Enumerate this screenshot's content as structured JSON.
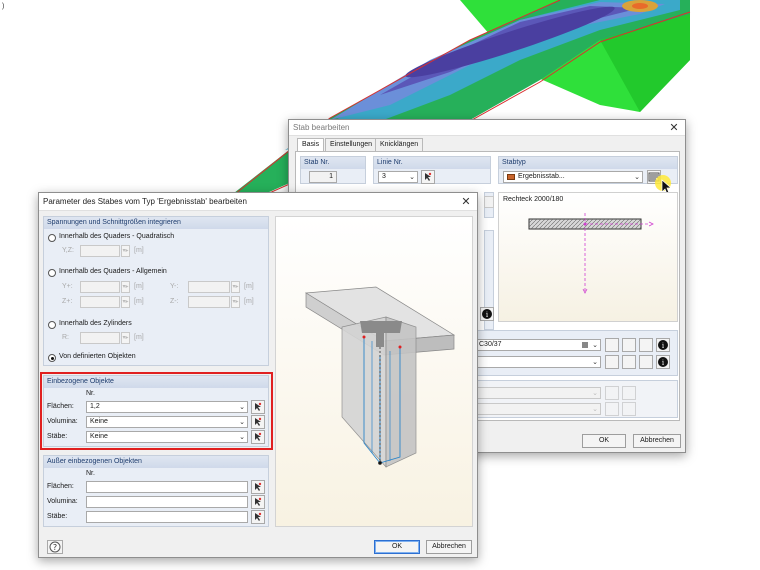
{
  "stab_dialog": {
    "title": "Stab bearbeiten",
    "tabs": [
      "Basis",
      "Einstellungen",
      "Knicklängen"
    ],
    "stab_nr_label": "Stab Nr.",
    "stab_nr_value": "1",
    "linie_nr_label": "Linie Nr.",
    "linie_nr_value": "3",
    "stabtyp_label": "Stabtyp",
    "stabtyp_value": "Ergebnisstab...",
    "section_name": "Rechteck 2000/180",
    "material_value": "C30/37",
    "ok_label": "OK",
    "cancel_label": "Abbrechen"
  },
  "param_dialog": {
    "title": "Parameter des Stabes vom Typ 'Ergebnisstab' bearbeiten",
    "group1": {
      "header": "Spannungen und Schnittgrößen integrieren",
      "opt1": "Innerhalb des Quaders - Quadratisch",
      "opt1_yz": "Y,Z:",
      "opt2": "Innerhalb des Quaders - Allgemein",
      "opt2_yplus": "Y+:",
      "opt2_yminus": "Y-:",
      "opt2_zplus": "Z+:",
      "opt2_zminus": "Z-:",
      "opt3": "Innerhalb des Zylinders",
      "opt3_r": "R:",
      "opt4": "Von definierten Objekten",
      "unit": "[m]"
    },
    "included": {
      "header": "Einbezogene Objekte",
      "col_nr": "Nr.",
      "flaechen_label": "Flächen:",
      "flaechen_value": "1,2",
      "volumina_label": "Volumina:",
      "volumina_value": "Keine",
      "staebe_label": "Stäbe:",
      "staebe_value": "Keine"
    },
    "excluded": {
      "header": "Außer einbezogenen Objekten",
      "col_nr": "Nr.",
      "flaechen_label": "Flächen:",
      "volumina_label": "Volumina:",
      "staebe_label": "Stäbe:"
    },
    "ok_label": "OK",
    "cancel_label": "Abbrechen"
  },
  "colors": {
    "highlight_frame": "#e02020",
    "section_header_text": "#1f3d6e",
    "default_button_border": "#2c6fd1"
  }
}
